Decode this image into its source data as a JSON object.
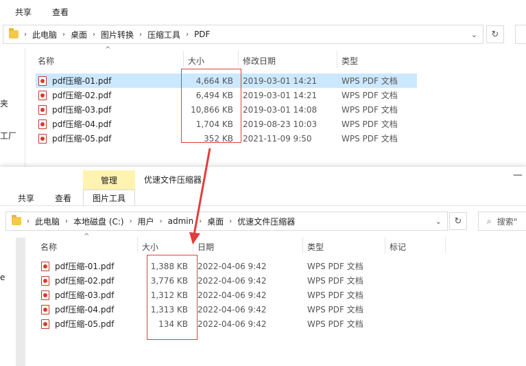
{
  "top": {
    "menu": [
      "共享",
      "查看"
    ],
    "breadcrumb": [
      "此电脑",
      "桌面",
      "图片转换",
      "压缩工具",
      "PDF"
    ],
    "columns": [
      "名称",
      "大小",
      "修改日期",
      "类型"
    ],
    "sidebar": [
      "夹",
      "工厂"
    ],
    "files": [
      {
        "name": "pdf压缩-01.pdf",
        "size": "4,664 KB",
        "date": "2019-03-01 14:21",
        "type": "WPS PDF 文档"
      },
      {
        "name": "pdf压缩-02.pdf",
        "size": "6,494 KB",
        "date": "2019-03-01 14:21",
        "type": "WPS PDF 文档"
      },
      {
        "name": "pdf压缩-03.pdf",
        "size": "10,866 KB",
        "date": "2019-03-01 14:08",
        "type": "WPS PDF 文档"
      },
      {
        "name": "pdf压缩-04.pdf",
        "size": "1,704 KB",
        "date": "2019-08-23 10:03",
        "type": "WPS PDF 文档"
      },
      {
        "name": "pdf压缩-05.pdf",
        "size": "352 KB",
        "date": "2021-11-09 9:50",
        "type": "WPS PDF 文档"
      }
    ]
  },
  "bottom": {
    "ribbon_tab": "管理",
    "window_title": "优速文件压缩器",
    "menu": [
      "共享",
      "查看",
      "图片工具"
    ],
    "breadcrumb": [
      "此电脑",
      "本地磁盘 (C:)",
      "用户",
      "admin",
      "桌面",
      "优速文件压缩器"
    ],
    "search_placeholder": "搜索\"",
    "columns": [
      "名称",
      "大小",
      "日期",
      "类型",
      "标记"
    ],
    "sidebar": [
      "e"
    ],
    "files": [
      {
        "name": "pdf压缩-01.pdf",
        "size": "1,388 KB",
        "date": "2022-04-06 9:42",
        "type": "WPS PDF 文档"
      },
      {
        "name": "pdf压缩-02.pdf",
        "size": "3,776 KB",
        "date": "2022-04-06 9:42",
        "type": "WPS PDF 文档"
      },
      {
        "name": "pdf压缩-03.pdf",
        "size": "1,312 KB",
        "date": "2022-04-06 9:42",
        "type": "WPS PDF 文档"
      },
      {
        "name": "pdf压缩-04.pdf",
        "size": "1,313 KB",
        "date": "2022-04-06 9:42",
        "type": "WPS PDF 文档"
      },
      {
        "name": "pdf压缩-05.pdf",
        "size": "134 KB",
        "date": "2022-04-06 9:42",
        "type": "WPS PDF 文档"
      }
    ]
  },
  "colors": {
    "highlight": "#e23c3c",
    "selected_row": "#cce8ff",
    "ribbon_tab": "#fff3b0"
  }
}
